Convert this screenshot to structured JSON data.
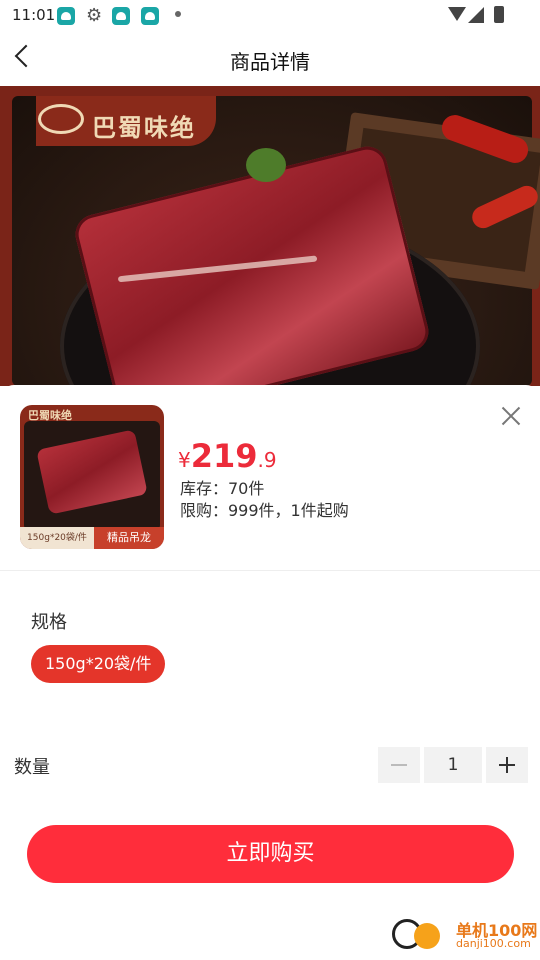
{
  "status_bar": {
    "time": "11:01"
  },
  "header": {
    "title": "商品详情"
  },
  "hero": {
    "brand_text": "巴蜀味绝"
  },
  "product": {
    "thumb_brand": "巴蜀味绝",
    "thumb_spec_tag": "150g*20袋/件",
    "thumb_badge": "精品吊龙",
    "price_currency": "¥",
    "price_integer": "219",
    "price_decimal": ".9",
    "stock": "库存：70件",
    "limit": "限购：999件，1件起购"
  },
  "spec": {
    "title": "规格",
    "options": [
      "150g*20袋/件"
    ]
  },
  "quantity": {
    "label": "数量",
    "value": "1"
  },
  "buy_button": {
    "label": "立即购买"
  },
  "watermark": {
    "name": "单机100网",
    "url": "danji100.com"
  },
  "colors": {
    "accent": "#ff2d3b",
    "chip": "#e4352a",
    "price": "#ec2b3a"
  }
}
